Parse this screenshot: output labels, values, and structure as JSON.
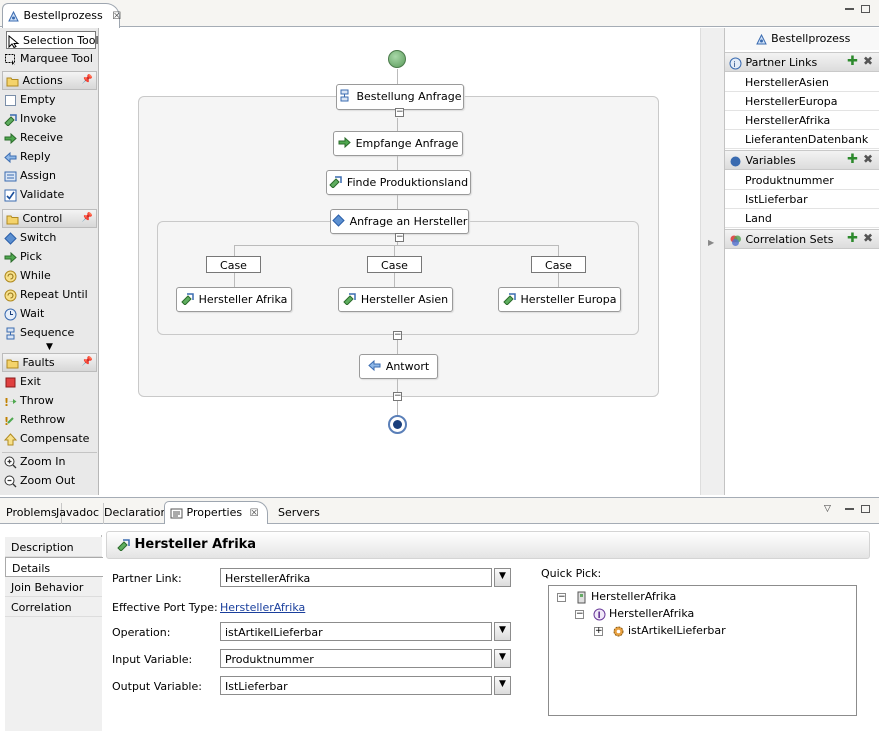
{
  "editor": {
    "tab_title": "Bestellprozess"
  },
  "palette": {
    "tools": [
      {
        "label": "Selection Tool"
      },
      {
        "label": "Marquee Tool"
      }
    ],
    "actions_title": "Actions",
    "actions": [
      {
        "label": "Empty"
      },
      {
        "label": "Invoke"
      },
      {
        "label": "Receive"
      },
      {
        "label": "Reply"
      },
      {
        "label": "Assign"
      },
      {
        "label": "Validate"
      }
    ],
    "control_title": "Control",
    "control": [
      {
        "label": "Switch"
      },
      {
        "label": "Pick"
      },
      {
        "label": "While"
      },
      {
        "label": "Repeat Until"
      },
      {
        "label": "Wait"
      },
      {
        "label": "Sequence"
      }
    ],
    "faults_title": "Faults",
    "faults": [
      {
        "label": "Exit"
      },
      {
        "label": "Throw"
      },
      {
        "label": "Rethrow"
      },
      {
        "label": "Compensate"
      }
    ],
    "zoom": [
      {
        "label": "Zoom In"
      },
      {
        "label": "Zoom Out"
      }
    ]
  },
  "process": {
    "receive": "Bestellung Anfrage",
    "empfange": "Empfange Anfrage",
    "finde": "Finde Produktionsland",
    "switch": "Anfrage an Hersteller",
    "cases": [
      {
        "label": "Case",
        "activity": "Hersteller Afrika"
      },
      {
        "label": "Case",
        "activity": "Hersteller Asien"
      },
      {
        "label": "Case",
        "activity": "Hersteller Europa"
      }
    ],
    "reply": "Antwort"
  },
  "outline": {
    "title": "Bestellprozess",
    "partner_links_title": "Partner Links",
    "partner_links": [
      "HerstellerAsien",
      "HerstellerEuropa",
      "HerstellerAfrika",
      "LieferantenDatenbank"
    ],
    "variables_title": "Variables",
    "variables": [
      "Produktnummer",
      "IstLieferbar",
      "Land"
    ],
    "correlation_title": "Correlation Sets"
  },
  "bottom_tabs": {
    "problems": "Problems",
    "javadoc": "Javadoc",
    "declaration": "Declaration",
    "properties": "Properties",
    "servers": "Servers"
  },
  "properties": {
    "title": "Hersteller Afrika",
    "nav": [
      "Description",
      "Details",
      "Join Behavior",
      "Correlation"
    ],
    "selected_nav": "Details",
    "partner_link_label": "Partner Link:",
    "partner_link_value": "HerstellerAfrika",
    "port_type_label": "Effective Port Type:",
    "port_type_value": "HerstellerAfrika",
    "operation_label": "Operation:",
    "operation_value": "istArtikelLieferbar",
    "input_label": "Input Variable:",
    "input_value": "Produktnummer",
    "output_label": "Output Variable:",
    "output_value": "IstLieferbar",
    "quick_pick_label": "Quick Pick:",
    "quick_pick_tree": [
      "HerstellerAfrika",
      "HerstellerAfrika",
      "istArtikelLieferbar"
    ]
  },
  "colors": {
    "start_node": "#6aa86a",
    "end_node": "#2a5ea8",
    "accent": "#2d8a2d"
  }
}
